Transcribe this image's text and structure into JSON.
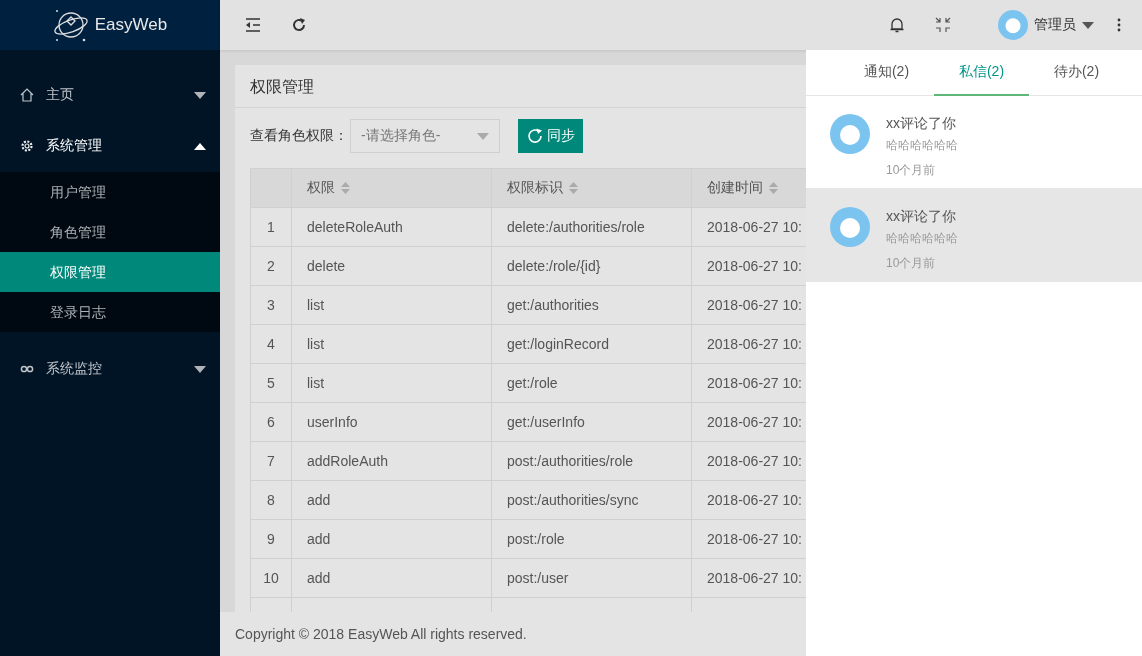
{
  "header": {
    "logo": "EasyWeb",
    "user": "管理员"
  },
  "sidebar": {
    "items": [
      {
        "label": "主页",
        "kind": "home",
        "expanded": false
      },
      {
        "label": "系统管理",
        "kind": "settings",
        "expanded": true,
        "children": [
          {
            "label": "用户管理",
            "selected": false
          },
          {
            "label": "角色管理",
            "selected": false
          },
          {
            "label": "权限管理",
            "selected": true
          },
          {
            "label": "登录日志",
            "selected": false
          }
        ]
      },
      {
        "label": "系统监控",
        "kind": "monitor",
        "expanded": false
      }
    ]
  },
  "card": {
    "title": "权限管理",
    "filter_label": "查看角色权限：",
    "role_select": {
      "placeholder": "-请选择角色-"
    },
    "sync_button": "同步"
  },
  "table": {
    "columns": [
      "权限",
      "权限标识",
      "创建时间"
    ],
    "rows": [
      {
        "index": "1",
        "name": "deleteRoleAuth",
        "identifier": "delete:/authorities/role",
        "created": "2018-06-27 10:"
      },
      {
        "index": "2",
        "name": "delete",
        "identifier": "delete:/role/{id}",
        "created": "2018-06-27 10:"
      },
      {
        "index": "3",
        "name": "list",
        "identifier": "get:/authorities",
        "created": "2018-06-27 10:"
      },
      {
        "index": "4",
        "name": "list",
        "identifier": "get:/loginRecord",
        "created": "2018-06-27 10:"
      },
      {
        "index": "5",
        "name": "list",
        "identifier": "get:/role",
        "created": "2018-06-27 10:"
      },
      {
        "index": "6",
        "name": "userInfo",
        "identifier": "get:/userInfo",
        "created": "2018-06-27 10:"
      },
      {
        "index": "7",
        "name": "addRoleAuth",
        "identifier": "post:/authorities/role",
        "created": "2018-06-27 10:"
      },
      {
        "index": "8",
        "name": "add",
        "identifier": "post:/authorities/sync",
        "created": "2018-06-27 10:"
      },
      {
        "index": "9",
        "name": "add",
        "identifier": "post:/role",
        "created": "2018-06-27 10:"
      },
      {
        "index": "10",
        "name": "add",
        "identifier": "post:/user",
        "created": "2018-06-27 10:"
      }
    ]
  },
  "footer": "Copyright © 2018 EasyWeb All rights reserved.",
  "message_panel": {
    "tabs": [
      {
        "label": "通知(2)",
        "selected": false
      },
      {
        "label": "私信(2)",
        "selected": true
      },
      {
        "label": "待办(2)",
        "selected": false
      }
    ],
    "messages": [
      {
        "title": "xx评论了你",
        "body": "哈哈哈哈哈哈",
        "time": "10个月前",
        "highlighted": false
      },
      {
        "title": "xx评论了你",
        "body": "哈哈哈哈哈哈",
        "time": "10个月前",
        "highlighted": true
      }
    ]
  }
}
